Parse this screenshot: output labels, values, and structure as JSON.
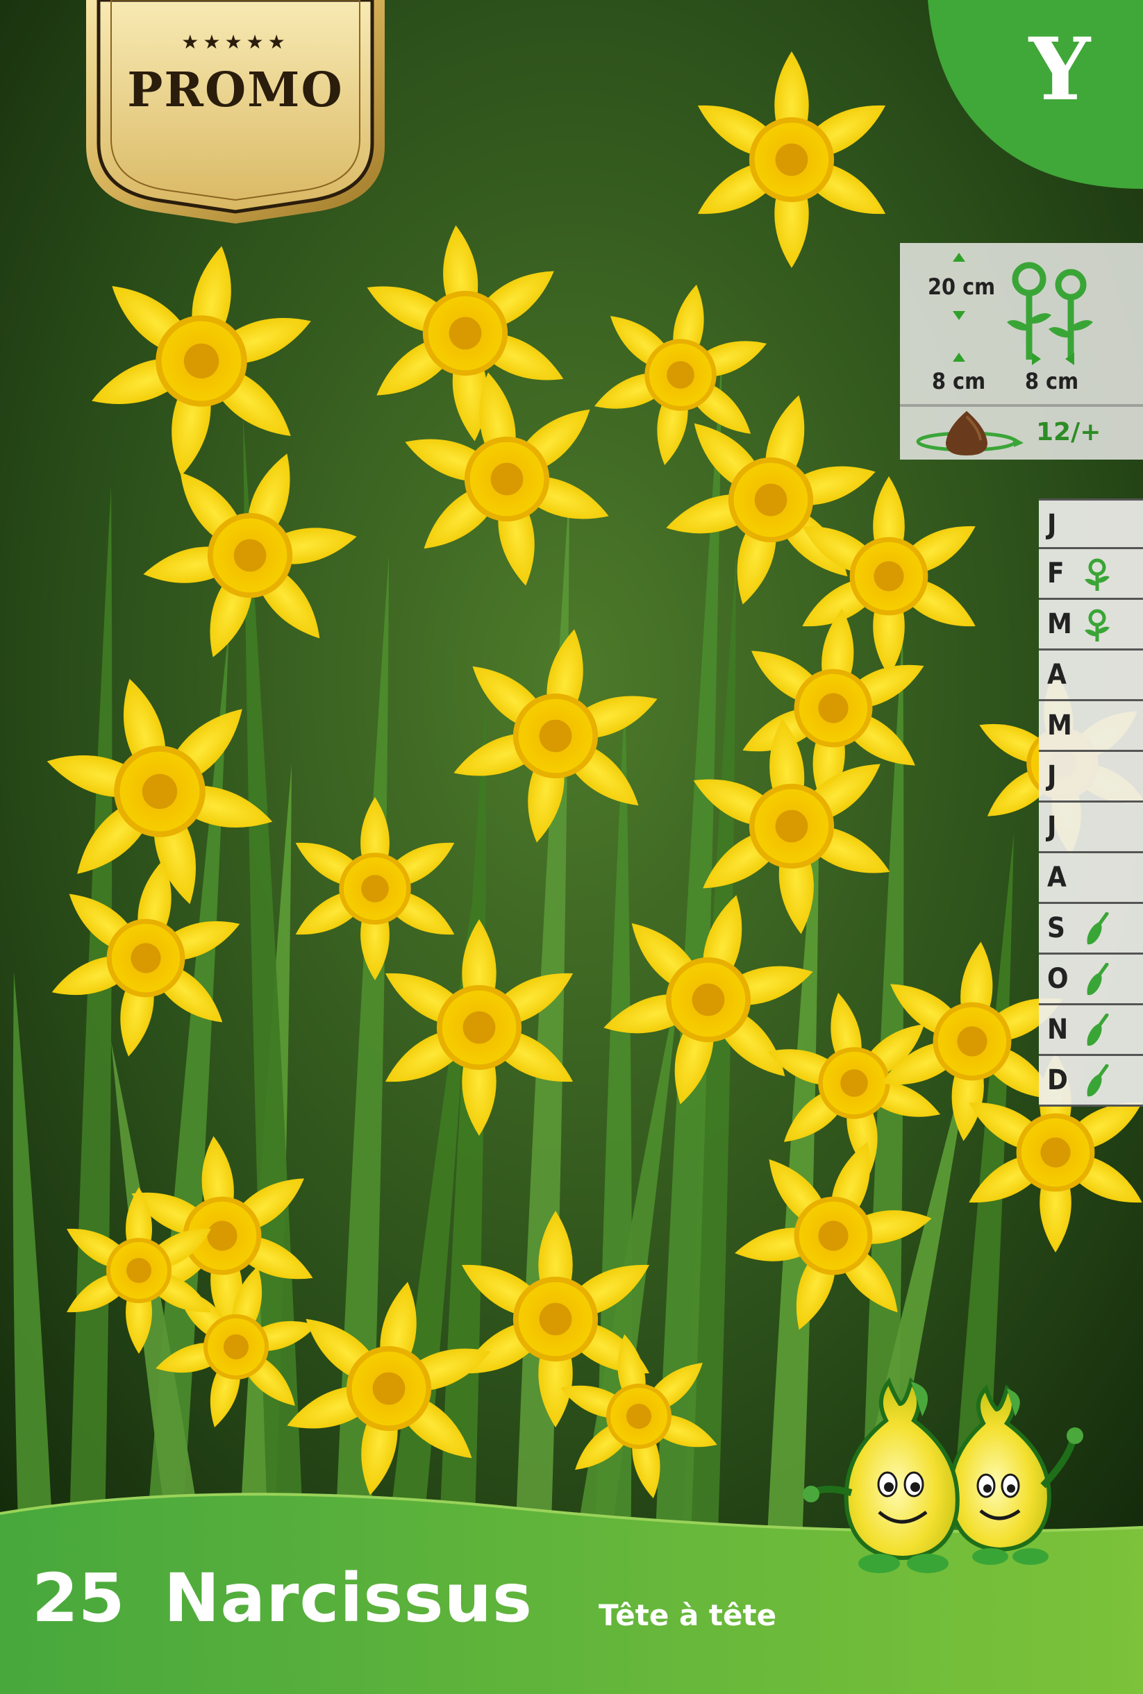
{
  "badge": {
    "stars": "★★★★★",
    "label": "PROMO"
  },
  "corner": {
    "letter": "Y"
  },
  "info": {
    "height": "20 cm",
    "depth": "8 cm",
    "spacing": "8 cm",
    "count": "12/+"
  },
  "calendar": [
    {
      "letter": "J",
      "icon": "none"
    },
    {
      "letter": "F",
      "icon": "flower-icon"
    },
    {
      "letter": "M",
      "icon": "flower-icon"
    },
    {
      "letter": "A",
      "icon": "none"
    },
    {
      "letter": "M",
      "icon": "none"
    },
    {
      "letter": "J",
      "icon": "none"
    },
    {
      "letter": "J",
      "icon": "none"
    },
    {
      "letter": "A",
      "icon": "none"
    },
    {
      "letter": "S",
      "icon": "trowel-icon"
    },
    {
      "letter": "O",
      "icon": "trowel-icon"
    },
    {
      "letter": "N",
      "icon": "trowel-icon"
    },
    {
      "letter": "D",
      "icon": "trowel-icon"
    }
  ],
  "product": {
    "count": "25",
    "name": "Narcissus",
    "variety": "Tête à tête"
  },
  "colors": {
    "brand_green": "#3aa537",
    "daffodil_yellow": "#f6d80a",
    "gold": "#c9a040"
  }
}
